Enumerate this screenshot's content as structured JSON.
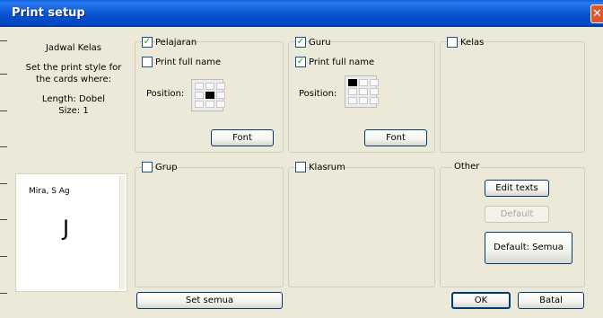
{
  "window": {
    "title": "Print setup",
    "close_glyph": "✕"
  },
  "info": {
    "class_name": "Jadwal Kelas",
    "instruction": "Set the print style for the cards where:",
    "length": "Length: Dobel",
    "size": "Size: 1"
  },
  "preview": {
    "name": "Mira, S Ag",
    "letter": "J"
  },
  "groups": {
    "pelajaran": {
      "label": "Pelajaran",
      "checked": true,
      "full_name_label": "Print full name",
      "full_name_checked": false,
      "position_label": "Position:",
      "font_label": "Font"
    },
    "guru": {
      "label": "Guru",
      "checked": true,
      "full_name_label": "Print full name",
      "full_name_checked": true,
      "position_label": "Position:",
      "font_label": "Font"
    },
    "kelas": {
      "label": "Kelas",
      "checked": false
    },
    "grup": {
      "label": "Grup",
      "checked": false
    },
    "klasrum": {
      "label": "Klasrum",
      "checked": false
    }
  },
  "other": {
    "label": "Other",
    "edit_texts": "Edit texts",
    "default": "Default",
    "default_semua": "Default: Semua"
  },
  "buttons": {
    "set_semua": "Set semua",
    "ok": "OK",
    "batal": "Batal"
  }
}
